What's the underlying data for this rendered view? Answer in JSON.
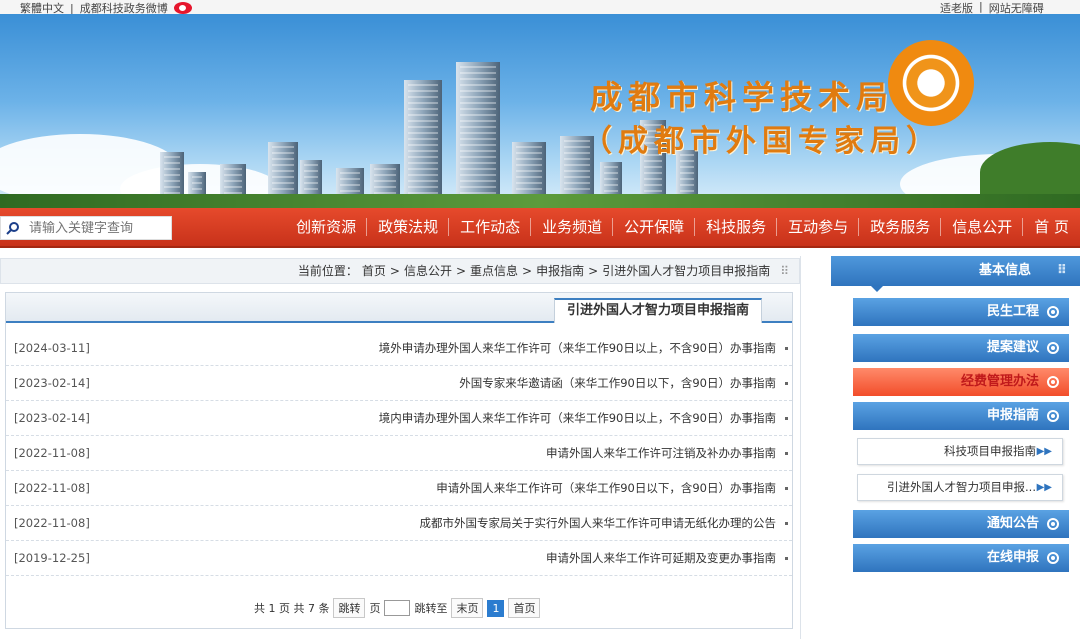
{
  "topbar": {
    "left_links": [
      "网站无障碍",
      "适老版"
    ],
    "right_links": [
      "繁體中文",
      "成都科技政务微博"
    ],
    "weibo_icon": "weibo-icon"
  },
  "banner": {
    "title": "成都市科学技术局",
    "subtitle": "（成都市外国专家局）"
  },
  "nav": {
    "items": [
      "首 页",
      "信息公开",
      "政务服务",
      "互动参与",
      "科技服务",
      "公开保障",
      "业务频道",
      "工作动态",
      "政策法规",
      "创新资源"
    ],
    "search_placeholder": "请输入关键字查询"
  },
  "breadcrumb": {
    "label": "当前位置：",
    "path": [
      "首页",
      ">",
      "信息公开",
      ">",
      "重点信息",
      ">",
      "申报指南",
      ">",
      "引进外国人才智力项目申报指南"
    ]
  },
  "panel": {
    "tab_title": "引进外国人才智力项目申报指南",
    "rows": [
      {
        "title": "境外申请办理外国人来华工作许可（来华工作90日以上，不含90日）办事指南",
        "date": "[2024-03-11]"
      },
      {
        "title": "外国专家来华邀请函（来华工作90日以下，含90日）办事指南",
        "date": "[2023-02-14]"
      },
      {
        "title": "境内申请办理外国人来华工作许可（来华工作90日以上，不含90日）办事指南",
        "date": "[2023-02-14]"
      },
      {
        "title": "申请外国人来华工作许可注销及补办办事指南",
        "date": "[2022-11-08]"
      },
      {
        "title": "申请外国人来华工作许可（来华工作90日以下，含90日）办事指南",
        "date": "[2022-11-08]"
      },
      {
        "title": "成都市外国专家局关于实行外国人来华工作许可申请无纸化办理的公告",
        "date": "[2022-11-08]"
      },
      {
        "title": "申请外国人来华工作许可延期及变更办事指南",
        "date": "[2019-12-25]"
      }
    ]
  },
  "pager": {
    "first": "首页",
    "current": "1",
    "last": "末页",
    "goto": "跳转至",
    "page_unit": "页",
    "jump": "跳转",
    "summary": "共 1 页 共 7 条"
  },
  "sidebar": {
    "head": "基本信息",
    "menu": [
      {
        "label": "民生工程"
      },
      {
        "label": "提案建议"
      },
      {
        "label": "经费管理办法"
      },
      {
        "label": "申报指南"
      },
      {
        "label": "通知公告"
      },
      {
        "label": "在线申报"
      }
    ],
    "sub": [
      {
        "label": "科技项目申报指南"
      },
      {
        "label": "引进外国人才智力项目申报..."
      }
    ]
  },
  "colors": {
    "nav_red": "#d63a20",
    "accent_blue": "#2f74be",
    "title_orange": "#e07b10"
  }
}
